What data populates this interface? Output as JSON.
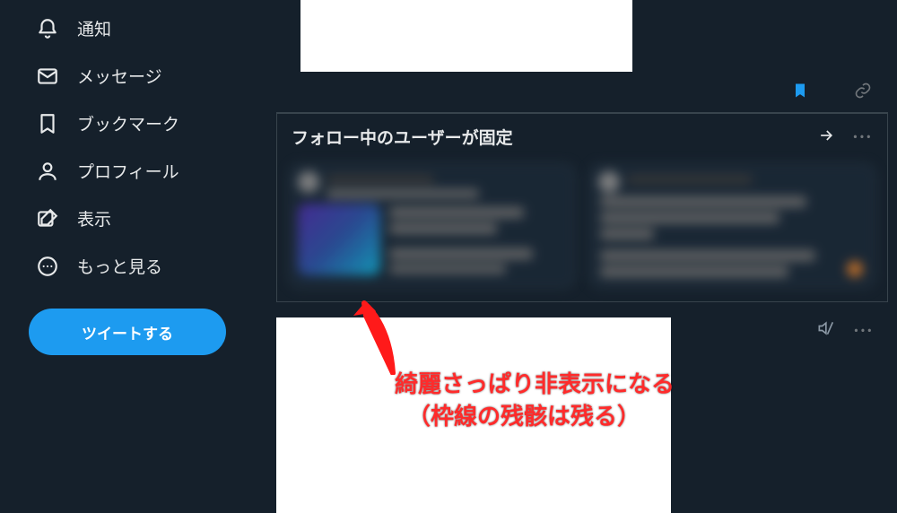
{
  "sidebar": {
    "items": [
      {
        "label": "通知"
      },
      {
        "label": "メッセージ"
      },
      {
        "label": "ブックマーク"
      },
      {
        "label": "プロフィール"
      },
      {
        "label": "表示"
      },
      {
        "label": "もっと見る"
      }
    ],
    "tweet_button": "ツイートする"
  },
  "pinned": {
    "title": "フォロー中のユーザーが固定"
  },
  "annotation": {
    "line1": "綺麗さっぱり非表示になる",
    "line2": "（枠線の残骸は残る）"
  },
  "colors": {
    "accent": "#1d9bf0",
    "background": "#15202b"
  }
}
